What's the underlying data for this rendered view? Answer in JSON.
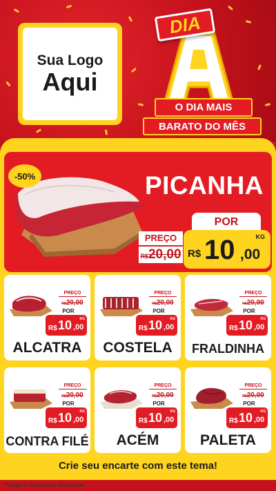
{
  "header": {
    "logo": {
      "line1": "Sua Logo",
      "line2": "Aqui"
    },
    "campaign": {
      "badge": "DIA",
      "letter": "A",
      "line1": "O DIA MAIS",
      "line2": "BARATO DO MÊS"
    }
  },
  "hero": {
    "discount": "-50%",
    "name": "PICANHA",
    "old_label": "PREÇO",
    "old_currency": "R$",
    "old_price": "20,00",
    "new_label": "POR",
    "currency": "R$",
    "price_int": "10",
    "price_cents": ",00",
    "unit": "KG"
  },
  "products": [
    {
      "name": "ALCATRA",
      "old_label": "PREÇO",
      "old_currency": "R$",
      "old_price": "20,00",
      "new_label": "POR",
      "currency": "R$",
      "price_int": "10",
      "price_cents": ",00",
      "unit": "KG"
    },
    {
      "name": "COSTELA",
      "old_label": "PREÇO",
      "old_currency": "R$",
      "old_price": "20,00",
      "new_label": "POR",
      "currency": "R$",
      "price_int": "10",
      "price_cents": ",00",
      "unit": "KG"
    },
    {
      "name": "FRALDINHA",
      "old_label": "PREÇO",
      "old_currency": "R$",
      "old_price": "20,00",
      "new_label": "POR",
      "currency": "R$",
      "price_int": "10",
      "price_cents": ",00",
      "unit": "KG"
    },
    {
      "name": "CONTRA FILÉ",
      "old_label": "PREÇO",
      "old_currency": "R$",
      "old_price": "20,00",
      "new_label": "POR",
      "currency": "R$",
      "price_int": "10",
      "price_cents": ",00",
      "unit": "KG"
    },
    {
      "name": "ACÉM",
      "old_label": "PREÇO",
      "old_currency": "R$",
      "old_price": "20,00",
      "new_label": "POR",
      "currency": "R$",
      "price_int": "10",
      "price_cents": ",00",
      "unit": "KG"
    },
    {
      "name": "PALETA",
      "old_label": "PREÇO",
      "old_currency": "R$",
      "old_price": "20,00",
      "new_label": "POR",
      "currency": "R$",
      "price_int": "10",
      "price_cents": ",00",
      "unit": "KG"
    }
  ],
  "footer": {
    "cta": "Crie seu encarte com este tema!",
    "disclaimer": "*Imagens Meramente Ilustrativas"
  },
  "colors": {
    "primary_red": "#e31b23",
    "dark_red": "#c4121b",
    "yellow": "#ffd41f",
    "meat": "#c52535",
    "board": "#c98a4b"
  }
}
